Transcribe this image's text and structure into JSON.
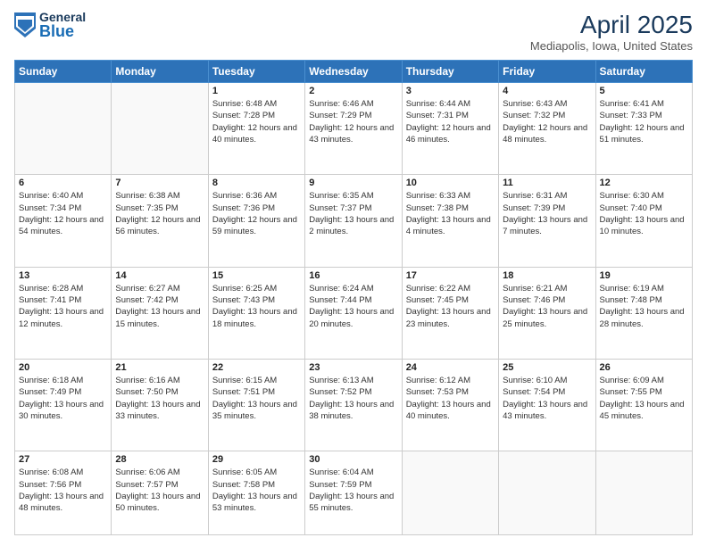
{
  "header": {
    "logo": {
      "general": "General",
      "blue": "Blue"
    },
    "title": "April 2025",
    "location": "Mediapolis, Iowa, United States"
  },
  "weekdays": [
    "Sunday",
    "Monday",
    "Tuesday",
    "Wednesday",
    "Thursday",
    "Friday",
    "Saturday"
  ],
  "weeks": [
    [
      {
        "day": "",
        "info": ""
      },
      {
        "day": "",
        "info": ""
      },
      {
        "day": "1",
        "info": "Sunrise: 6:48 AM\nSunset: 7:28 PM\nDaylight: 12 hours and 40 minutes."
      },
      {
        "day": "2",
        "info": "Sunrise: 6:46 AM\nSunset: 7:29 PM\nDaylight: 12 hours and 43 minutes."
      },
      {
        "day": "3",
        "info": "Sunrise: 6:44 AM\nSunset: 7:31 PM\nDaylight: 12 hours and 46 minutes."
      },
      {
        "day": "4",
        "info": "Sunrise: 6:43 AM\nSunset: 7:32 PM\nDaylight: 12 hours and 48 minutes."
      },
      {
        "day": "5",
        "info": "Sunrise: 6:41 AM\nSunset: 7:33 PM\nDaylight: 12 hours and 51 minutes."
      }
    ],
    [
      {
        "day": "6",
        "info": "Sunrise: 6:40 AM\nSunset: 7:34 PM\nDaylight: 12 hours and 54 minutes."
      },
      {
        "day": "7",
        "info": "Sunrise: 6:38 AM\nSunset: 7:35 PM\nDaylight: 12 hours and 56 minutes."
      },
      {
        "day": "8",
        "info": "Sunrise: 6:36 AM\nSunset: 7:36 PM\nDaylight: 12 hours and 59 minutes."
      },
      {
        "day": "9",
        "info": "Sunrise: 6:35 AM\nSunset: 7:37 PM\nDaylight: 13 hours and 2 minutes."
      },
      {
        "day": "10",
        "info": "Sunrise: 6:33 AM\nSunset: 7:38 PM\nDaylight: 13 hours and 4 minutes."
      },
      {
        "day": "11",
        "info": "Sunrise: 6:31 AM\nSunset: 7:39 PM\nDaylight: 13 hours and 7 minutes."
      },
      {
        "day": "12",
        "info": "Sunrise: 6:30 AM\nSunset: 7:40 PM\nDaylight: 13 hours and 10 minutes."
      }
    ],
    [
      {
        "day": "13",
        "info": "Sunrise: 6:28 AM\nSunset: 7:41 PM\nDaylight: 13 hours and 12 minutes."
      },
      {
        "day": "14",
        "info": "Sunrise: 6:27 AM\nSunset: 7:42 PM\nDaylight: 13 hours and 15 minutes."
      },
      {
        "day": "15",
        "info": "Sunrise: 6:25 AM\nSunset: 7:43 PM\nDaylight: 13 hours and 18 minutes."
      },
      {
        "day": "16",
        "info": "Sunrise: 6:24 AM\nSunset: 7:44 PM\nDaylight: 13 hours and 20 minutes."
      },
      {
        "day": "17",
        "info": "Sunrise: 6:22 AM\nSunset: 7:45 PM\nDaylight: 13 hours and 23 minutes."
      },
      {
        "day": "18",
        "info": "Sunrise: 6:21 AM\nSunset: 7:46 PM\nDaylight: 13 hours and 25 minutes."
      },
      {
        "day": "19",
        "info": "Sunrise: 6:19 AM\nSunset: 7:48 PM\nDaylight: 13 hours and 28 minutes."
      }
    ],
    [
      {
        "day": "20",
        "info": "Sunrise: 6:18 AM\nSunset: 7:49 PM\nDaylight: 13 hours and 30 minutes."
      },
      {
        "day": "21",
        "info": "Sunrise: 6:16 AM\nSunset: 7:50 PM\nDaylight: 13 hours and 33 minutes."
      },
      {
        "day": "22",
        "info": "Sunrise: 6:15 AM\nSunset: 7:51 PM\nDaylight: 13 hours and 35 minutes."
      },
      {
        "day": "23",
        "info": "Sunrise: 6:13 AM\nSunset: 7:52 PM\nDaylight: 13 hours and 38 minutes."
      },
      {
        "day": "24",
        "info": "Sunrise: 6:12 AM\nSunset: 7:53 PM\nDaylight: 13 hours and 40 minutes."
      },
      {
        "day": "25",
        "info": "Sunrise: 6:10 AM\nSunset: 7:54 PM\nDaylight: 13 hours and 43 minutes."
      },
      {
        "day": "26",
        "info": "Sunrise: 6:09 AM\nSunset: 7:55 PM\nDaylight: 13 hours and 45 minutes."
      }
    ],
    [
      {
        "day": "27",
        "info": "Sunrise: 6:08 AM\nSunset: 7:56 PM\nDaylight: 13 hours and 48 minutes."
      },
      {
        "day": "28",
        "info": "Sunrise: 6:06 AM\nSunset: 7:57 PM\nDaylight: 13 hours and 50 minutes."
      },
      {
        "day": "29",
        "info": "Sunrise: 6:05 AM\nSunset: 7:58 PM\nDaylight: 13 hours and 53 minutes."
      },
      {
        "day": "30",
        "info": "Sunrise: 6:04 AM\nSunset: 7:59 PM\nDaylight: 13 hours and 55 minutes."
      },
      {
        "day": "",
        "info": ""
      },
      {
        "day": "",
        "info": ""
      },
      {
        "day": "",
        "info": ""
      }
    ]
  ]
}
